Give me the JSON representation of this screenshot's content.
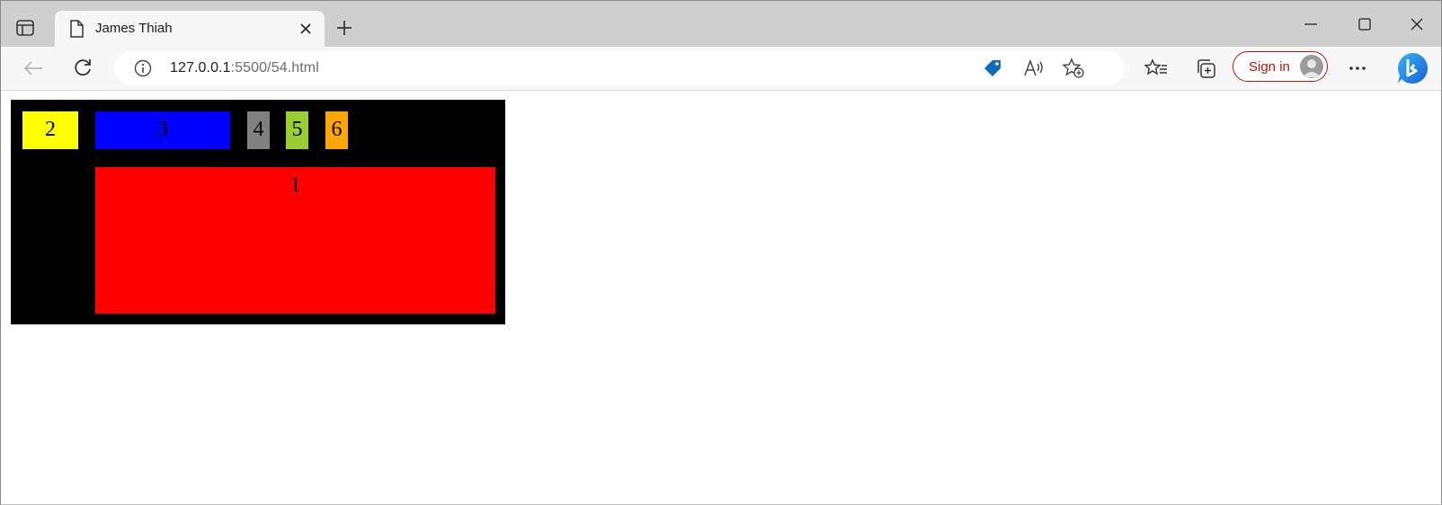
{
  "browser": {
    "tab": {
      "title": "James Thiah"
    },
    "address": {
      "host": "127.0.0.1",
      "rest": ":5500/54.html"
    },
    "signin_label": "Sign in"
  },
  "grid": {
    "items": [
      {
        "label": "2",
        "color": "#ffff00"
      },
      {
        "label": "3",
        "color": "#0000ff"
      },
      {
        "label": "4",
        "color": "#808080"
      },
      {
        "label": "5",
        "color": "#9acd32"
      },
      {
        "label": "6",
        "color": "#ffa500"
      },
      {
        "label": "1",
        "color": "#ff0000"
      }
    ],
    "background": "#000000"
  },
  "icons": [
    "tab-actions-icon",
    "document-icon",
    "close-icon",
    "new-tab-icon",
    "minimize-icon",
    "maximize-icon",
    "window-close-icon",
    "back-icon",
    "refresh-icon",
    "info-icon",
    "tag-icon",
    "read-aloud-icon",
    "add-favorite-icon",
    "favorites-icon",
    "collections-icon",
    "more-icon",
    "bing-icon",
    "profile-avatar-icon"
  ]
}
